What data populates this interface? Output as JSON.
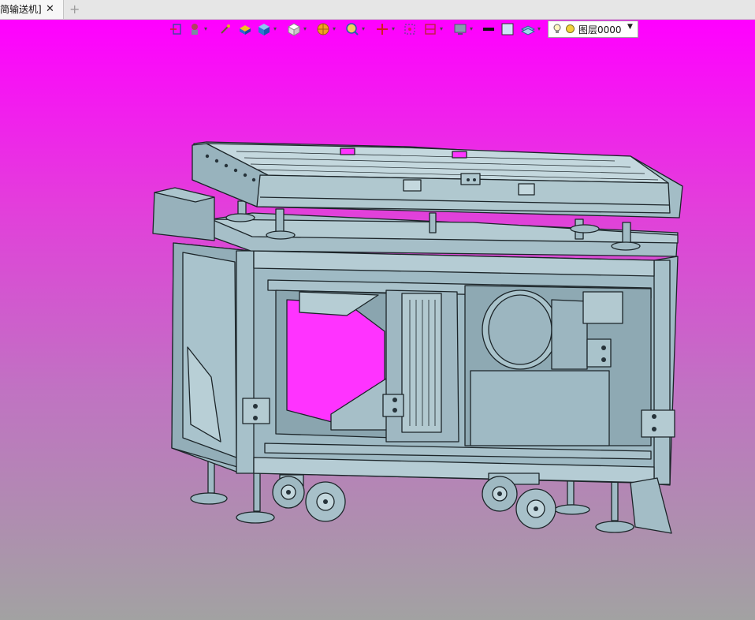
{
  "tab": {
    "title": "简输送机]",
    "close": "✕",
    "new_tab": "+"
  },
  "toolbar": {
    "icons": [
      "exit-icon",
      "rotate-icon",
      "sketch-icon",
      "box-face-icon",
      "cube-view-icon",
      "cube-display-icon",
      "render-style-icon",
      "zoom-icon",
      "origin-axis-icon",
      "fit-view-icon",
      "section-icon",
      "display-icon",
      "line-color-icon",
      "face-color-icon",
      "layer-stack-icon"
    ],
    "layer_label": "图层0000"
  },
  "colors": {
    "viewport_top": "#ff00ff",
    "viewport_bottom": "#a2a2a2",
    "model": "#9fbac4",
    "edge": "#1c2529"
  }
}
